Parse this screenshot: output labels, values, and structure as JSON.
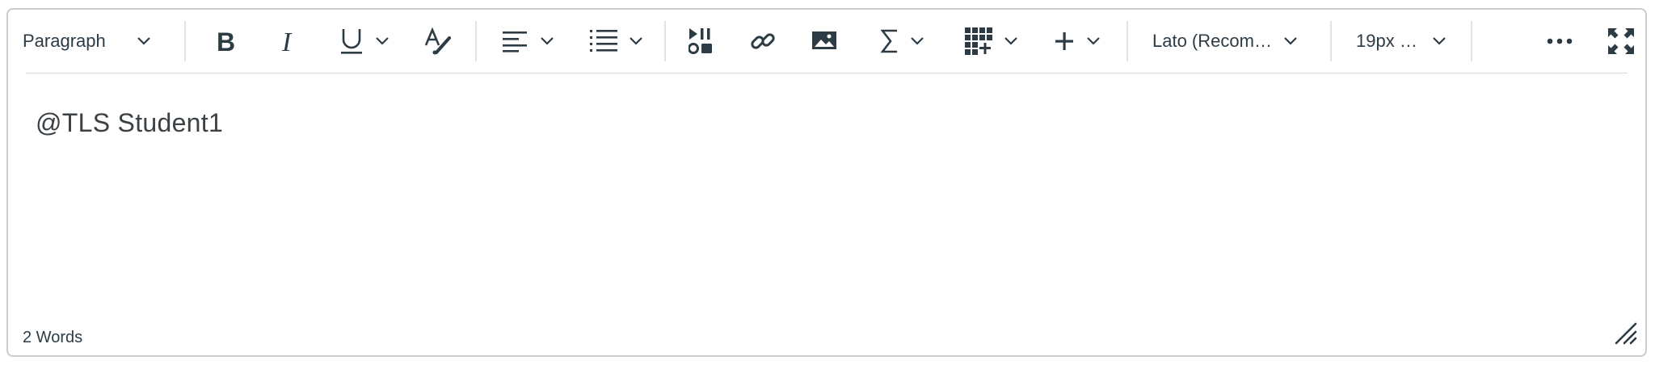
{
  "toolbar": {
    "block_format": "Paragraph",
    "font_family": "Lato (Recom…",
    "font_size": "19px …",
    "icons": [
      "bold-icon",
      "italic-icon",
      "underline-icon",
      "text-color-icon",
      "align-left-icon",
      "list-icon",
      "media-icon",
      "link-icon",
      "image-icon",
      "equation-icon",
      "table-icon",
      "plus-icon",
      "more-icon",
      "fullscreen-icon"
    ]
  },
  "editor": {
    "content_text": "@TLS Student1"
  },
  "status": {
    "word_count": "2 Words"
  },
  "colors": {
    "text": "#2d3b45",
    "border": "#c7cdd1",
    "divider": "#dfe3e6"
  }
}
